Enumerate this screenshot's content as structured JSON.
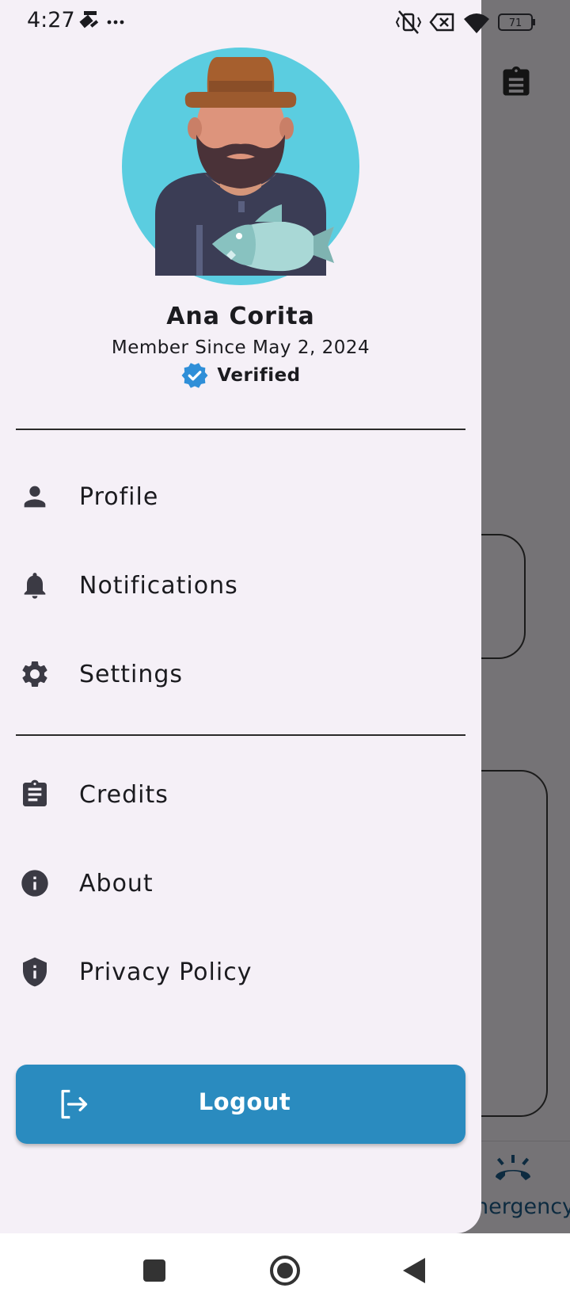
{
  "status_bar": {
    "time": "4:27",
    "left_icons": [
      "satellite-fake-icon",
      "more-dots-icon"
    ],
    "right_icons": [
      "vibrate-off-icon",
      "no-data-icon",
      "wifi-icon",
      "battery-icon"
    ],
    "battery_level": "71"
  },
  "background": {
    "emergency_label": "nergency"
  },
  "drawer": {
    "user": {
      "name": "Ana Corita",
      "member_since": "Member Since May 2, 2024",
      "verified_label": "Verified"
    },
    "menu_primary": [
      {
        "label": "Profile",
        "icon": "person-icon"
      },
      {
        "label": "Notifications",
        "icon": "bell-icon"
      },
      {
        "label": "Settings",
        "icon": "gear-icon"
      }
    ],
    "menu_secondary": [
      {
        "label": "Credits",
        "icon": "clipboard-icon"
      },
      {
        "label": "About",
        "icon": "info-icon"
      },
      {
        "label": "Privacy Policy",
        "icon": "shield-icon"
      }
    ],
    "logout_label": "Logout"
  },
  "colors": {
    "drawer_bg": "#f5f0f7",
    "accent": "#2a8bbf",
    "verified": "#2f8fd8",
    "text": "#1b1b1f"
  }
}
